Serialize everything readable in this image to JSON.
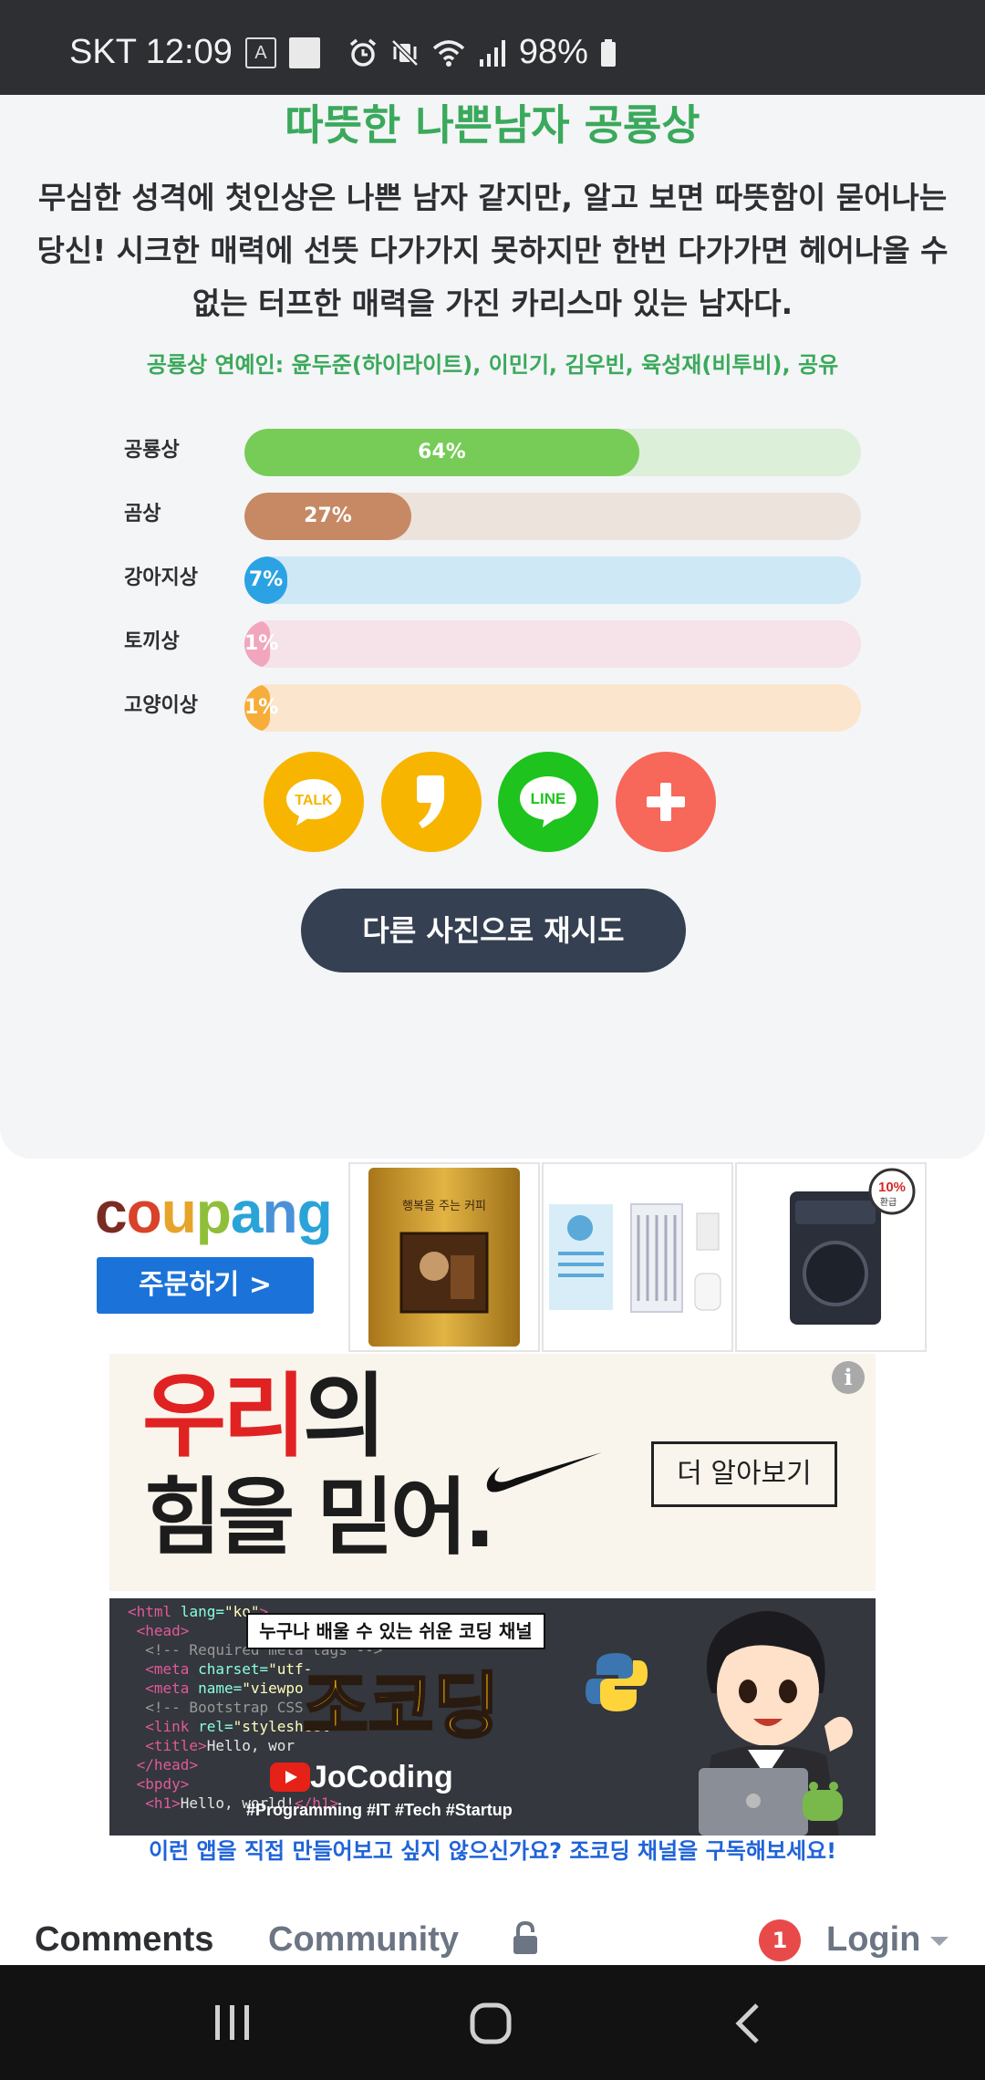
{
  "status_bar": {
    "carrier_time": "SKT 12:09",
    "badge_letter": "A",
    "battery": "98%"
  },
  "result": {
    "title": "따뜻한 나쁜남자 공룡상",
    "description": "무심한 성격에 첫인상은 나쁜 남자 같지만, 알고 보면 따뜻함이 묻어나는 당신! 시크한 매력에 선뜻 다가가지 못하지만 한번 다가가면 헤어나올 수 없는 터프한 매력을 가진 카리스마 있는 남자다.",
    "celebrities": "공룡상 연예인: 윤두준(하이라이트), 이민기, 김우빈, 육성재(비투비), 공유",
    "scores": [
      {
        "label": "공룡상",
        "percent": 64,
        "text": "64%",
        "fill_color": "#76cc57",
        "track_color": "#dcefd9"
      },
      {
        "label": "곰상",
        "percent": 27,
        "text": "27%",
        "fill_color": "#c68963",
        "track_color": "#ece3dd"
      },
      {
        "label": "강아지상",
        "percent": 7,
        "text": "7%",
        "fill_color": "#2ba2e4",
        "track_color": "#cfe8f6"
      },
      {
        "label": "토끼상",
        "percent": 1,
        "text": "1%",
        "fill_color": "#f1a6bd",
        "track_color": "#f6e2e9"
      },
      {
        "label": "고양이상",
        "percent": 1,
        "text": "1%",
        "fill_color": "#f6ad3a",
        "track_color": "#fbe6cd"
      }
    ],
    "share_buttons": [
      {
        "name": "kakaotalk-share-button",
        "icon": "talk-bubble-icon",
        "text": "TALK",
        "color": "#f7b500"
      },
      {
        "name": "kakaostory-share-button",
        "icon": "comma-icon",
        "text": "",
        "color": "#f7b500"
      },
      {
        "name": "line-share-button",
        "icon": "line-icon",
        "text": "LINE",
        "color": "#1ec31e"
      },
      {
        "name": "more-share-button",
        "icon": "plus-icon",
        "text": "",
        "color": "#f7675a"
      }
    ],
    "retry_label": "다른 사진으로 재시도"
  },
  "ads": {
    "coupang": {
      "logo": "coupang",
      "order_button": "주문하기 >",
      "coffee_label": "행복을 주는 커피",
      "washer_badge": "10%",
      "washer_badge_sub": "환급"
    },
    "nike": {
      "slogan_line1": "우리의",
      "slogan_line2": "힘을 믿어.",
      "more_button": "더 알아보기",
      "info": "i"
    },
    "jocoding": {
      "banner": "누구나 배울 수 있는 쉬운 코딩 채널",
      "title": "조코딩",
      "brand": "JoCoding",
      "tags": "#Programming #IT #Tech #Startup",
      "caption": "이런 앱을 직접 만들어보고 싶지 않으신가요? 조코딩 채널을 구독해보세요!"
    }
  },
  "comments": {
    "tabs": [
      "Comments",
      "Community"
    ],
    "notification_count": "1",
    "login_label": "Login"
  },
  "colors": {
    "accent_green": "#3aa95b",
    "retry_button": "#354152",
    "link_blue": "#1f63d8"
  }
}
